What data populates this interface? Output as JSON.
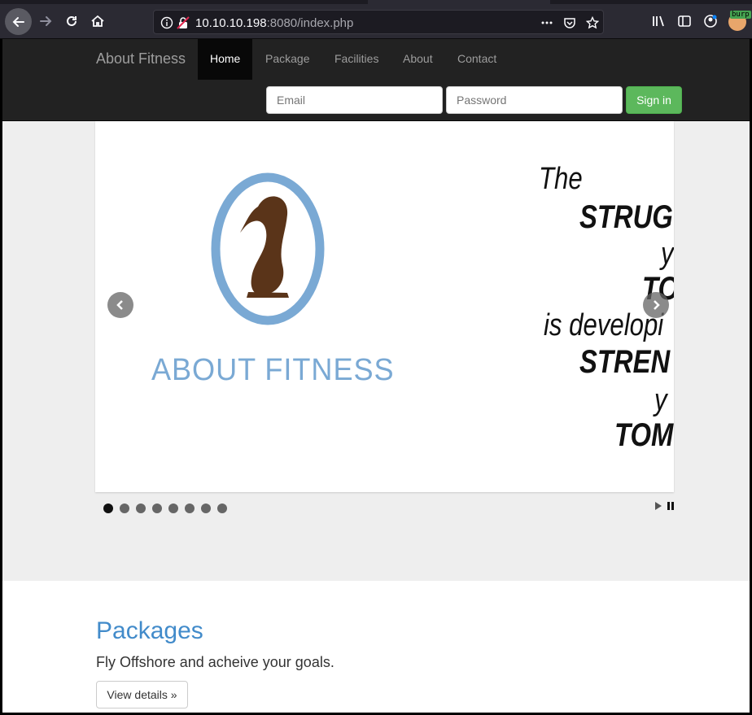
{
  "browser": {
    "url_host": "10.10.10.198",
    "url_rest": ":8080/index.php",
    "extension_badge": "burp"
  },
  "site": {
    "brand": "About Fitness",
    "nav": [
      "Home",
      "Package",
      "Facilities",
      "About",
      "Contact"
    ],
    "active_nav": "Home",
    "login": {
      "email_placeholder": "Email",
      "password_placeholder": "Password",
      "signin_label": "Sign in"
    }
  },
  "carousel": {
    "logo_text": "ABOUT FITNESS",
    "quote_lines": [
      "The",
      "STRUG",
      "y",
      "TO",
      "is developi",
      "STREN",
      "y",
      "TOM"
    ],
    "slide_count": 8,
    "active_slide": 1
  },
  "packages": {
    "title": "Packages",
    "text": "Fly Offshore and acheive your goals.",
    "button_label": "View details »"
  },
  "colors": {
    "brand_blue": "#428bca",
    "success_green": "#5cb85c",
    "logo_ring": "#7aa9d4",
    "logo_figure": "#5a3419"
  }
}
